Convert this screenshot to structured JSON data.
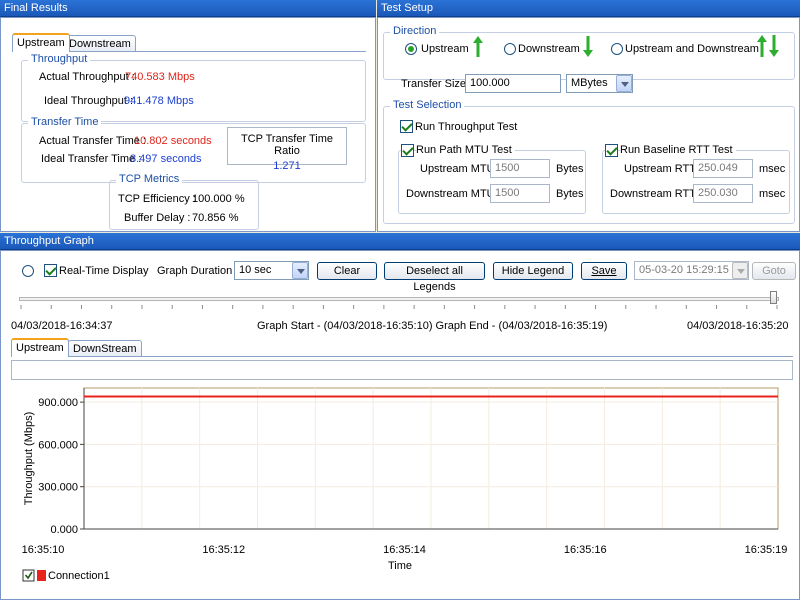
{
  "final_results": {
    "title": "Final Results",
    "tabs": [
      "Upstream",
      "Downstream"
    ],
    "throughput_group": "Throughput",
    "actual_throughput_label": "Actual Throughput :",
    "actual_throughput_value": "740.583 Mbps",
    "ideal_throughput_label": "Ideal Throughput :",
    "ideal_throughput_value": "941.478 Mbps",
    "transfer_group": "Transfer Time",
    "actual_transfer_label": "Actual Transfer Time :",
    "actual_transfer_value": "10.802 seconds",
    "ideal_transfer_label": "Ideal Transfer Time :",
    "ideal_transfer_value": "8.497 seconds",
    "ratio_label": "TCP Transfer Time Ratio",
    "ratio_value": "1.271",
    "metrics_group": "TCP Metrics",
    "efficiency_label": "TCP Efficiency :",
    "efficiency_value": "100.000 %",
    "buffer_label": "Buffer Delay :",
    "buffer_value": "70.856 %"
  },
  "test_setup": {
    "title": "Test Setup",
    "direction_group": "Direction",
    "direction_options": [
      "Upstream",
      "Downstream",
      "Upstream and Downstream"
    ],
    "selected_direction": "Upstream",
    "transfer_size_label": "Transfer Size",
    "transfer_size_value": "100.000",
    "transfer_unit": "MBytes",
    "selection_group": "Test Selection",
    "run_throughput": "Run Throughput Test",
    "run_path_mtu": "Run Path MTU Test",
    "upstream_mtu_label": "Upstream MTU",
    "upstream_mtu_value": "1500",
    "downstream_mtu_label": "Downstream MTU",
    "downstream_mtu_value": "1500",
    "bytes_unit": "Bytes",
    "run_rtt": "Run Baseline RTT Test",
    "upstream_rtt_label": "Upstream RTT",
    "upstream_rtt_value": "250.049",
    "downstream_rtt_label": "Downstream RTT",
    "downstream_rtt_value": "250.030",
    "msec_unit": "msec"
  },
  "graph": {
    "title": "Throughput Graph",
    "realtime_label": "Real-Time Display",
    "duration_label": "Graph Duration",
    "duration_value": "10 sec",
    "clear": "Clear",
    "deselect": "Deselect all Legends",
    "hide_legend": "Hide Legend",
    "save": "Save",
    "date_value": "05-03-20 15:29:15",
    "goto": "Goto",
    "left_time": "04/03/2018-16:34:37",
    "range_text": "Graph Start - (04/03/2018-16:35:10) Graph End - (04/03/2018-16:35:19)",
    "right_time": "04/03/2018-16:35:20",
    "tabs": [
      "Upstream",
      "DownStream"
    ],
    "legend_label": "Connection1",
    "colors": {
      "series": "#e8231b",
      "accent": "#f3a21c"
    }
  },
  "chart_data": {
    "type": "line",
    "xlabel": "Time",
    "ylabel": "Throughput (Mbps)",
    "x_ticks": [
      "16:35:10",
      "16:35:12",
      "16:35:14",
      "16:35:16",
      "16:35:19"
    ],
    "y_ticks": [
      "900.000",
      "600.000",
      "300.000",
      "0.000"
    ],
    "ylim": [
      0,
      1000
    ],
    "grid": true,
    "series": [
      {
        "name": "Connection1",
        "color": "#e8231b",
        "x": [
          0,
          1
        ],
        "y": [
          940,
          940
        ]
      }
    ]
  }
}
